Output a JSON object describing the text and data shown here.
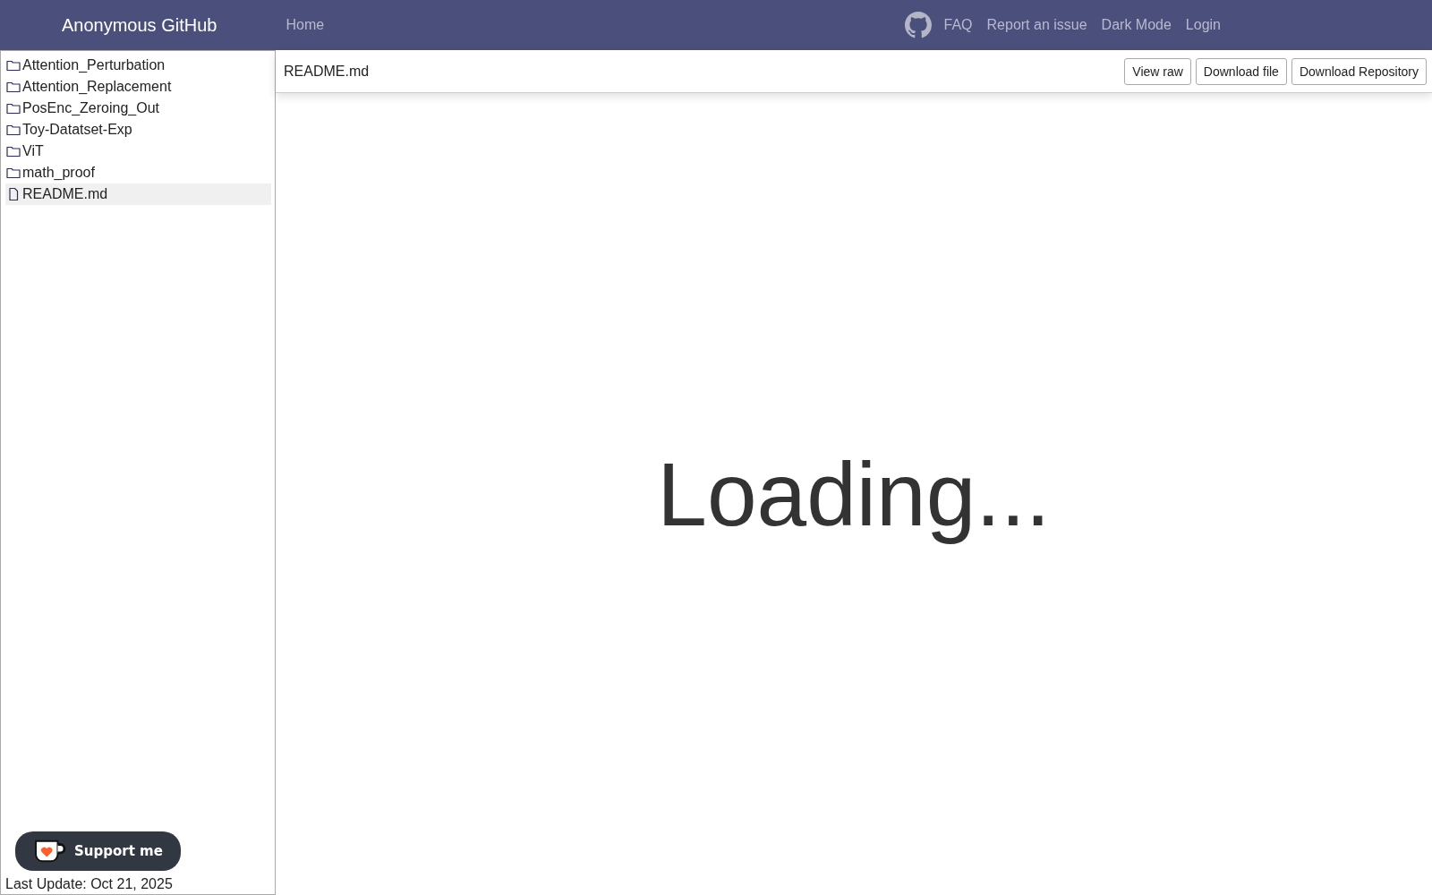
{
  "navbar": {
    "brand": "Anonymous GitHub",
    "links": [
      "Home"
    ],
    "right_links": [
      "FAQ",
      "Report an issue",
      "Dark Mode",
      "Login"
    ]
  },
  "sidebar": {
    "items": [
      {
        "name": "Attention_Perturbation",
        "kind": "folder",
        "selected": false
      },
      {
        "name": "Attention_Replacement",
        "kind": "folder",
        "selected": false
      },
      {
        "name": "PosEnc_Zeroing_Out",
        "kind": "folder",
        "selected": false
      },
      {
        "name": "Toy-Datatset-Exp",
        "kind": "folder",
        "selected": false
      },
      {
        "name": "ViT",
        "kind": "folder",
        "selected": false
      },
      {
        "name": "math_proof",
        "kind": "folder",
        "selected": false
      },
      {
        "name": "README.md",
        "kind": "file",
        "selected": true
      }
    ],
    "last_update": "Last Update: Oct 21, 2025"
  },
  "support_button": {
    "label": "Support me"
  },
  "file_header": {
    "path": "README.md",
    "buttons": [
      "View raw",
      "Download file",
      "Download Repository"
    ]
  },
  "content": {
    "message": "Loading..."
  }
}
